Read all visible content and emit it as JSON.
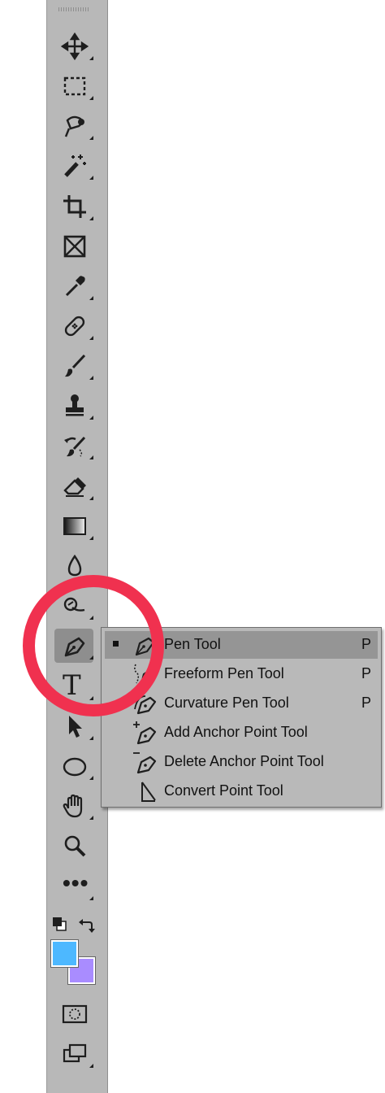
{
  "toolbar": {
    "tools": [
      {
        "name": "move",
        "icon": "move-icon"
      },
      {
        "name": "rectangular-marquee",
        "icon": "marquee-icon"
      },
      {
        "name": "lasso",
        "icon": "lasso-icon"
      },
      {
        "name": "magic-wand",
        "icon": "magic-wand-icon"
      },
      {
        "name": "crop",
        "icon": "crop-icon"
      },
      {
        "name": "frame",
        "icon": "frame-icon"
      },
      {
        "name": "eyedropper",
        "icon": "eyedropper-icon"
      },
      {
        "name": "healing-brush",
        "icon": "bandage-icon"
      },
      {
        "name": "brush",
        "icon": "brush-icon"
      },
      {
        "name": "clone-stamp",
        "icon": "stamp-icon"
      },
      {
        "name": "history-brush",
        "icon": "history-brush-icon"
      },
      {
        "name": "eraser",
        "icon": "eraser-icon"
      },
      {
        "name": "gradient",
        "icon": "gradient-icon"
      },
      {
        "name": "blur",
        "icon": "drop-icon"
      },
      {
        "name": "dodge",
        "icon": "dodge-icon"
      },
      {
        "name": "pen",
        "icon": "pen-icon",
        "active": true
      },
      {
        "name": "type",
        "icon": "type-icon",
        "glyph": "T"
      },
      {
        "name": "path-selection",
        "icon": "arrow-icon"
      },
      {
        "name": "ellipse",
        "icon": "ellipse-icon"
      },
      {
        "name": "hand",
        "icon": "hand-icon"
      },
      {
        "name": "zoom",
        "icon": "zoom-icon"
      },
      {
        "name": "edit-toolbar",
        "icon": "more-icon",
        "glyph": "•••"
      }
    ],
    "colors": {
      "foreground": "#4db8ff",
      "background": "#a98cff"
    }
  },
  "flyout": {
    "items": [
      {
        "label": "Pen Tool",
        "shortcut": "P",
        "selected": true
      },
      {
        "label": "Freeform Pen Tool",
        "shortcut": "P"
      },
      {
        "label": "Curvature Pen Tool",
        "shortcut": "P"
      },
      {
        "label": "Add Anchor Point Tool",
        "shortcut": ""
      },
      {
        "label": "Delete Anchor Point Tool",
        "shortcut": ""
      },
      {
        "label": "Convert Point Tool",
        "shortcut": ""
      }
    ]
  },
  "annotation": {
    "color": "#f0314f"
  }
}
